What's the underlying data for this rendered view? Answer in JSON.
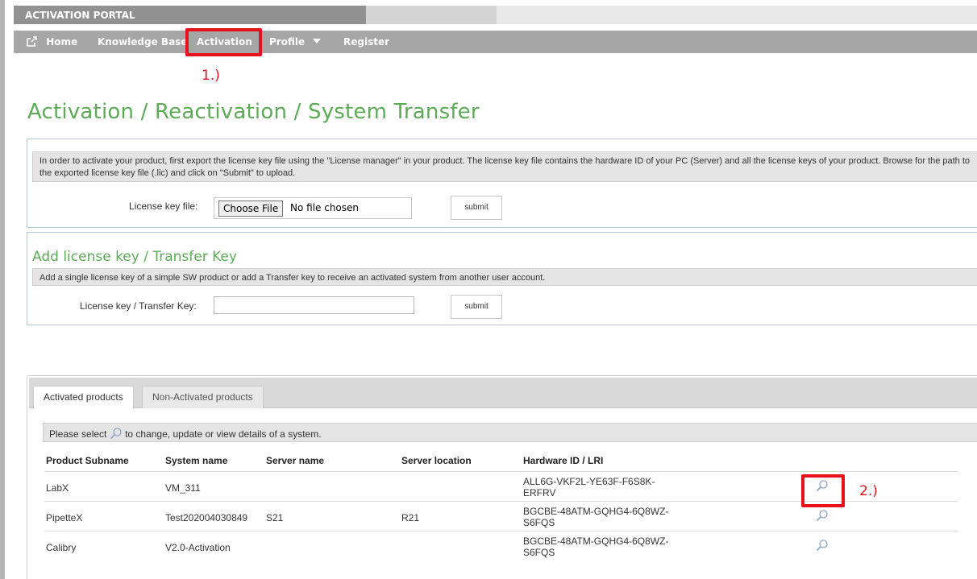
{
  "header": {
    "brand": "ACTIVATION PORTAL"
  },
  "nav": {
    "home": "Home",
    "knowledge_base": "Knowledge Base",
    "activation": "Activation",
    "profile": "Profile",
    "register": "Register"
  },
  "annotations": {
    "step1": "1.)",
    "step2": "2.)",
    "highlight_color": "#e8101a"
  },
  "page": {
    "title": "Activation / Reactivation / System Transfer",
    "accent_color": "#5dab57"
  },
  "license_file": {
    "instructions": "In order to activate your product, first export the license key file using the \"License manager\" in your product. The license key file contains the hardware ID of your PC (Server) and all the license keys of your product. Browse for the path to the exported license key file (.lic) and click on \"Submit\" to upload.",
    "label": "License key file:",
    "choose_button": "Choose File",
    "file_status": "No file chosen",
    "submit": "submit"
  },
  "add_key": {
    "title": "Add license key / Transfer Key",
    "instructions": "Add a single license key of a simple SW product or add a Transfer key to receive an activated system from another user account.",
    "label": "License key / Transfer Key:",
    "input_value": "",
    "submit": "submit"
  },
  "tabs": [
    {
      "label": "Activated products",
      "active": true
    },
    {
      "label": "Non-Activated products",
      "active": false
    }
  ],
  "products": {
    "hint_before": "Please select",
    "hint_after": "to change, update or view details of a system.",
    "columns": [
      "Product Subname",
      "System name",
      "Server name",
      "Server location",
      "Hardware ID / LRI"
    ],
    "rows": [
      {
        "subname": "LabX",
        "system": "VM_311",
        "server": "",
        "location": "",
        "hwid": "ALL6G-VKF2L-YE63F-F6S8K-ERFRV"
      },
      {
        "subname": "PipetteX",
        "system": "Test202004030849",
        "server": "S21",
        "location": "R21",
        "hwid": "BGCBE-48ATM-GQHG4-6Q8WZ-S6FQS"
      },
      {
        "subname": "Calibry",
        "system": "V2.0-Activation",
        "server": "",
        "location": "",
        "hwid": "BGCBE-48ATM-GQHG4-6Q8WZ-S6FQS"
      }
    ]
  },
  "icons": {
    "home": "external-link-icon",
    "details": "magnifier-icon",
    "profile_menu": "caret-down-icon"
  }
}
